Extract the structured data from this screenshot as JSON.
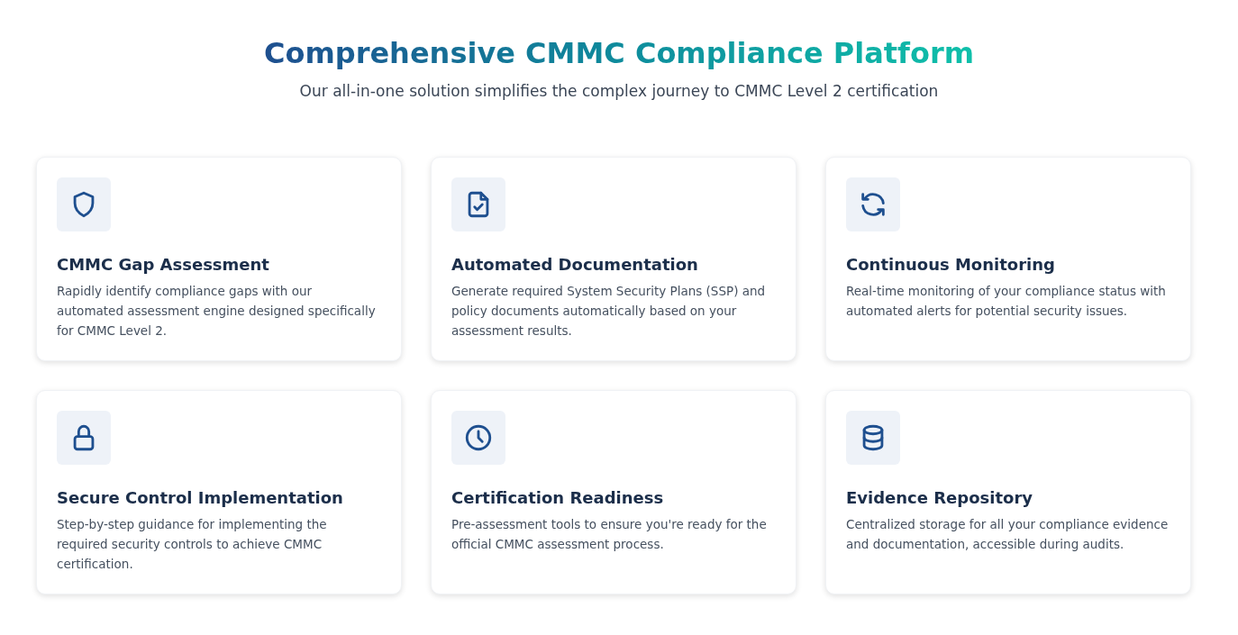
{
  "header": {
    "title": "Comprehensive CMMC Compliance Platform",
    "subtitle": "Our all-in-one solution simplifies the complex journey to CMMC Level 2 certification"
  },
  "features": [
    {
      "kind": "shield",
      "title": "CMMC Gap Assessment",
      "description": "Rapidly identify compliance gaps with our automated assessment engine designed specifically for CMMC Level 2."
    },
    {
      "kind": "document",
      "title": "Automated Documentation",
      "description": "Generate required System Security Plans (SSP) and policy documents automatically based on your assessment results."
    },
    {
      "kind": "refresh",
      "title": "Continuous Monitoring",
      "description": "Real-time monitoring of your compliance status with automated alerts for potential security issues."
    },
    {
      "kind": "lock",
      "title": "Secure Control Implementation",
      "description": "Step-by-step guidance for implementing the required security controls to achieve CMMC certification."
    },
    {
      "kind": "clock",
      "title": "Certification Readiness",
      "description": "Pre-assessment tools to ensure you're ready for the official CMMC assessment process."
    },
    {
      "kind": "database",
      "title": "Evidence Repository",
      "description": "Centralized storage for all your compliance evidence and documentation, accessible during audits."
    }
  ]
}
